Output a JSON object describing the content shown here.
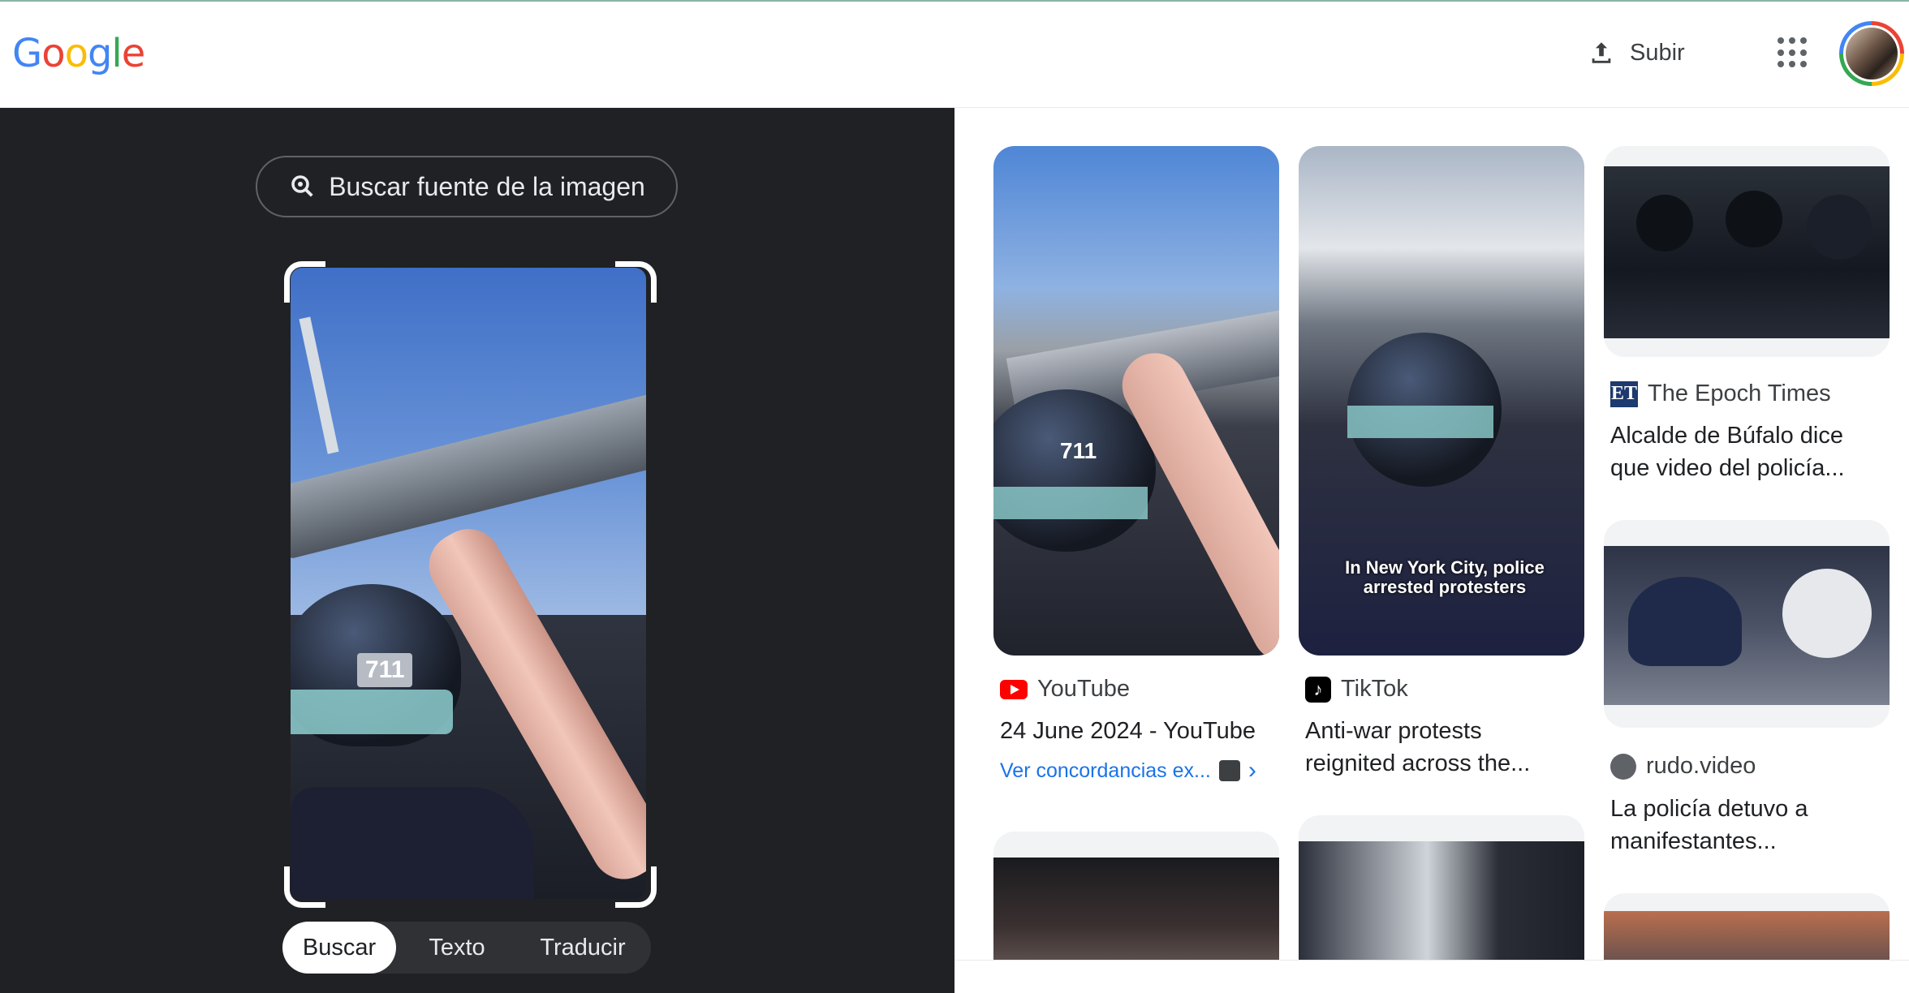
{
  "header": {
    "logo": "Google",
    "upload_label": "Subir",
    "apps_icon": "apps-grid-icon",
    "avatar_icon": "account-avatar"
  },
  "lens": {
    "source_button_label": "Buscar fuente de la imagen",
    "image_badge": "711",
    "modes": [
      "Buscar",
      "Texto",
      "Traducir"
    ],
    "active_mode": "Buscar"
  },
  "results": [
    {
      "source": "YouTube",
      "source_icon": "youtube-icon",
      "title": "24 June 2024 - YouTube",
      "match_link": "Ver concordancias ex...",
      "badge": "711"
    },
    {
      "source": "TikTok",
      "source_icon": "tiktok-icon",
      "title_lines": [
        "Anti-war protests",
        "reignited across the..."
      ],
      "overlay_text": "In New York City, police arrested protesters"
    },
    {
      "source": "The Epoch Times",
      "source_icon": "epoch-times-icon",
      "title_lines": [
        "Alcalde de Búfalo dice",
        "que video del policía..."
      ]
    },
    {
      "source": "rudo.video",
      "source_icon": "globe-icon",
      "title_lines": [
        "La policía detuvo a",
        "manifestantes..."
      ]
    }
  ],
  "colors": {
    "left_panel_bg": "#202124",
    "link_blue": "#1a73e8",
    "youtube_red": "#ff0000"
  }
}
